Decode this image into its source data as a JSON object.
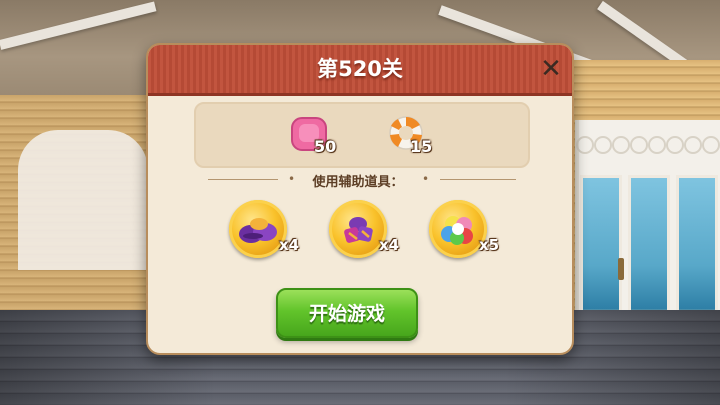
{
  "dialog": {
    "title": "第520关",
    "close_icon": "close-icon"
  },
  "goals": [
    {
      "name": "pink-jelly-icon",
      "count": "50"
    },
    {
      "name": "life-ring-icon",
      "count": "15"
    }
  ],
  "boosters_label": "使用辅助道具：",
  "boosters": [
    {
      "name": "purple-shoes-booster-icon",
      "count": "x4"
    },
    {
      "name": "candy-bomb-booster-icon",
      "count": "x4"
    },
    {
      "name": "rainbow-ball-booster-icon",
      "count": "x5"
    }
  ],
  "start_button": "开始游戏",
  "colors": {
    "header_red": "#c2553f",
    "start_green": "#62c42b",
    "coin_gold": "#f9c22b"
  }
}
